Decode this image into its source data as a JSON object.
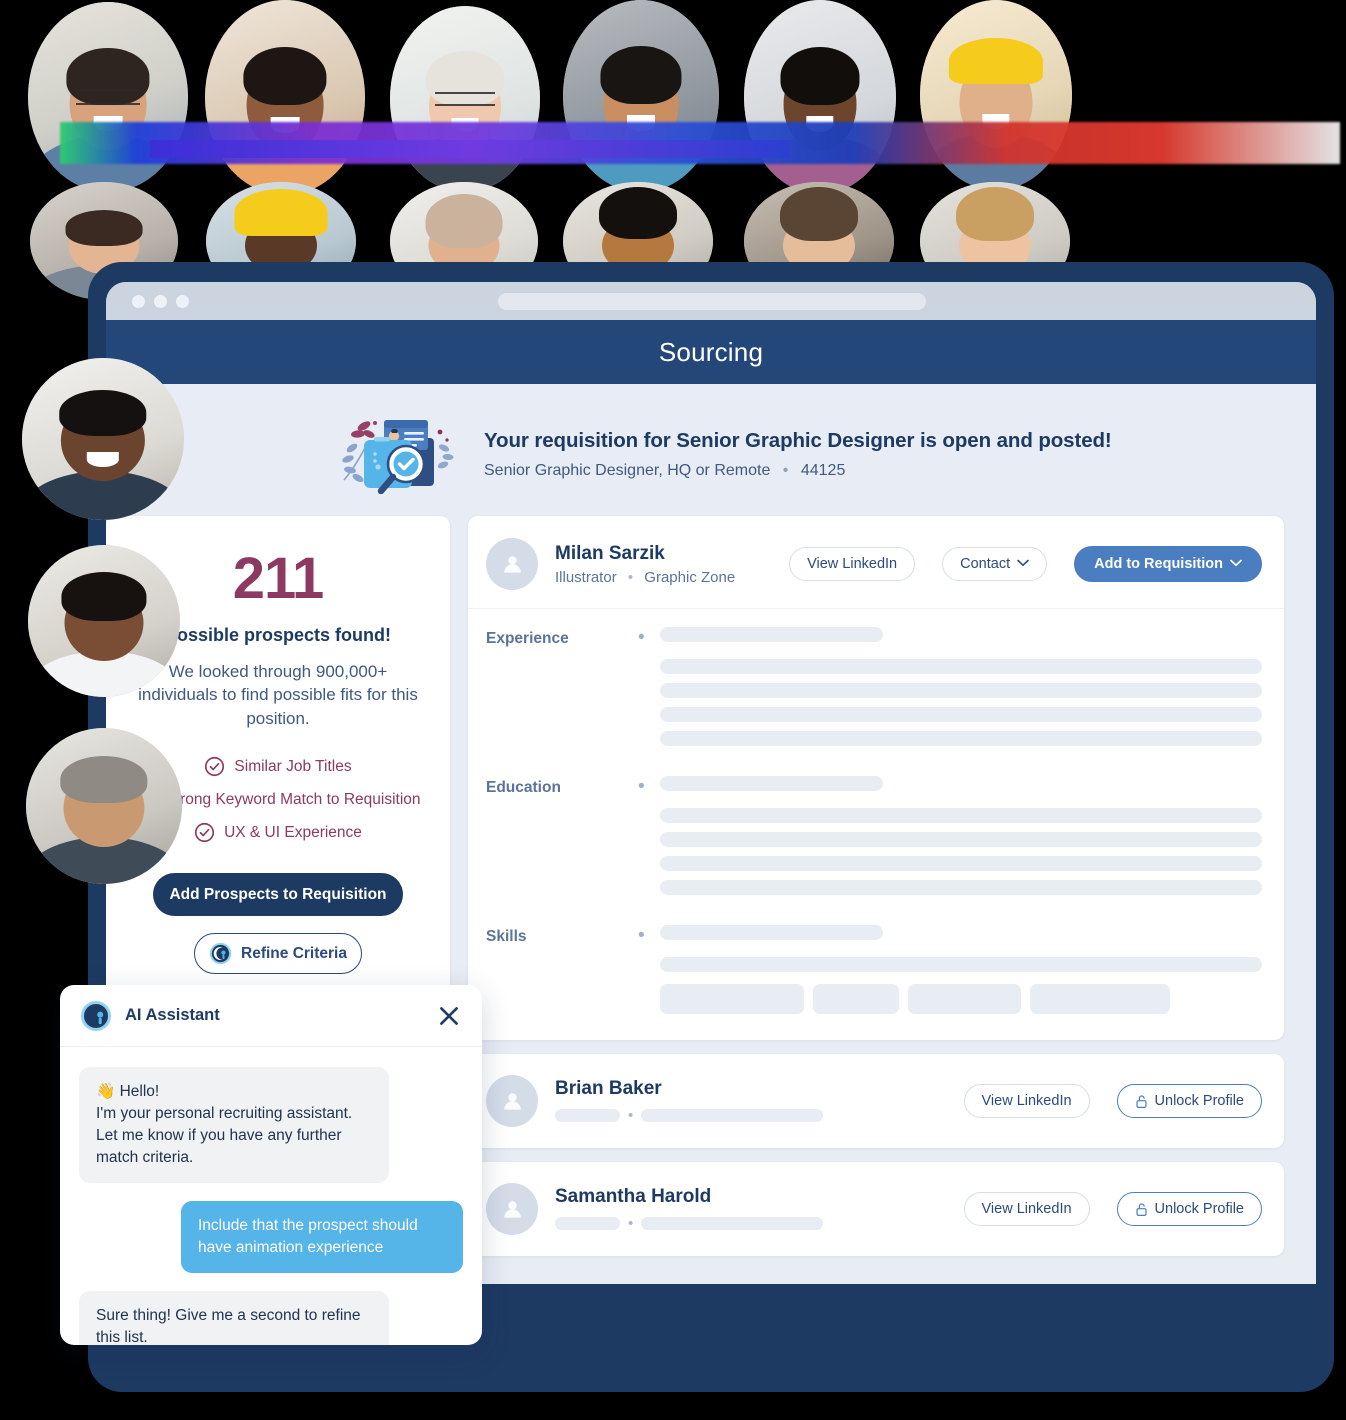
{
  "browser": {
    "dots": [
      "window-dot-1",
      "window-dot-2",
      "window-dot-3"
    ],
    "url_placeholder": ""
  },
  "header": {
    "title": "Sourcing"
  },
  "requisition": {
    "icon": "requisition-search-illustration",
    "headline": "Your requisition for Senior Graphic Designer is open and posted!",
    "subtitle_role": "Senior Graphic Designer, HQ or Remote",
    "separator": "•",
    "subtitle_id": "44125"
  },
  "stats": {
    "count": "211",
    "found_label": "Possible prospects found!",
    "description": "We looked through 900,000+ individuals to find possible fits for this position.",
    "criteria": [
      {
        "icon": "check-circle-icon",
        "label": "Similar Job Titles"
      },
      {
        "icon": "check-circle-icon",
        "label": "Strong Keyword Match to Requisition"
      },
      {
        "icon": "check-circle-icon",
        "label": "UX & UI Experience"
      }
    ],
    "primary_button": "Add Prospects to Requisition",
    "secondary_button": "Refine Criteria",
    "secondary_button_icon": "brand-logo-icon",
    "accent_color": "#8c3a62",
    "primary_color": "#1d3a63"
  },
  "candidate": {
    "avatar_icon": "person-avatar-icon",
    "name": "Milan Sarzik",
    "role": "Illustrator",
    "separator": "•",
    "company": "Graphic Zone",
    "actions": {
      "view_linkedin": "View LinkedIn",
      "contact": "Contact",
      "contact_caret": "chevron-down-icon",
      "add_to_requisition": "Add to Requisition",
      "add_caret": "chevron-down-icon"
    },
    "sections": [
      {
        "label": "Experience",
        "bullet": "•"
      },
      {
        "label": "Education",
        "bullet": "•"
      },
      {
        "label": "Skills",
        "bullet": "•"
      }
    ]
  },
  "more_candidates": [
    {
      "avatar_icon": "person-avatar-icon",
      "name": "Brian Baker",
      "view_linkedin": "View LinkedIn",
      "unlock_profile": "Unlock Profile",
      "unlock_icon": "lock-open-icon"
    },
    {
      "avatar_icon": "person-avatar-icon",
      "name": "Samantha Harold",
      "view_linkedin": "View LinkedIn",
      "unlock_profile": "Unlock Profile",
      "unlock_icon": "lock-open-icon"
    }
  ],
  "ai_assistant": {
    "logo_icon": "brand-logo-icon",
    "title": "AI Assistant",
    "close_icon": "close-icon",
    "messages": [
      {
        "from": "bot",
        "text": "👋 Hello!\nI'm your personal recruiting assistant. Let me know if you have any further match criteria."
      },
      {
        "from": "user",
        "text": "Include that the prospect should have animation experience"
      },
      {
        "from": "bot",
        "text": "Sure thing! Give me a second to refine this list."
      }
    ],
    "user_bubble_color": "#55b4e8"
  }
}
